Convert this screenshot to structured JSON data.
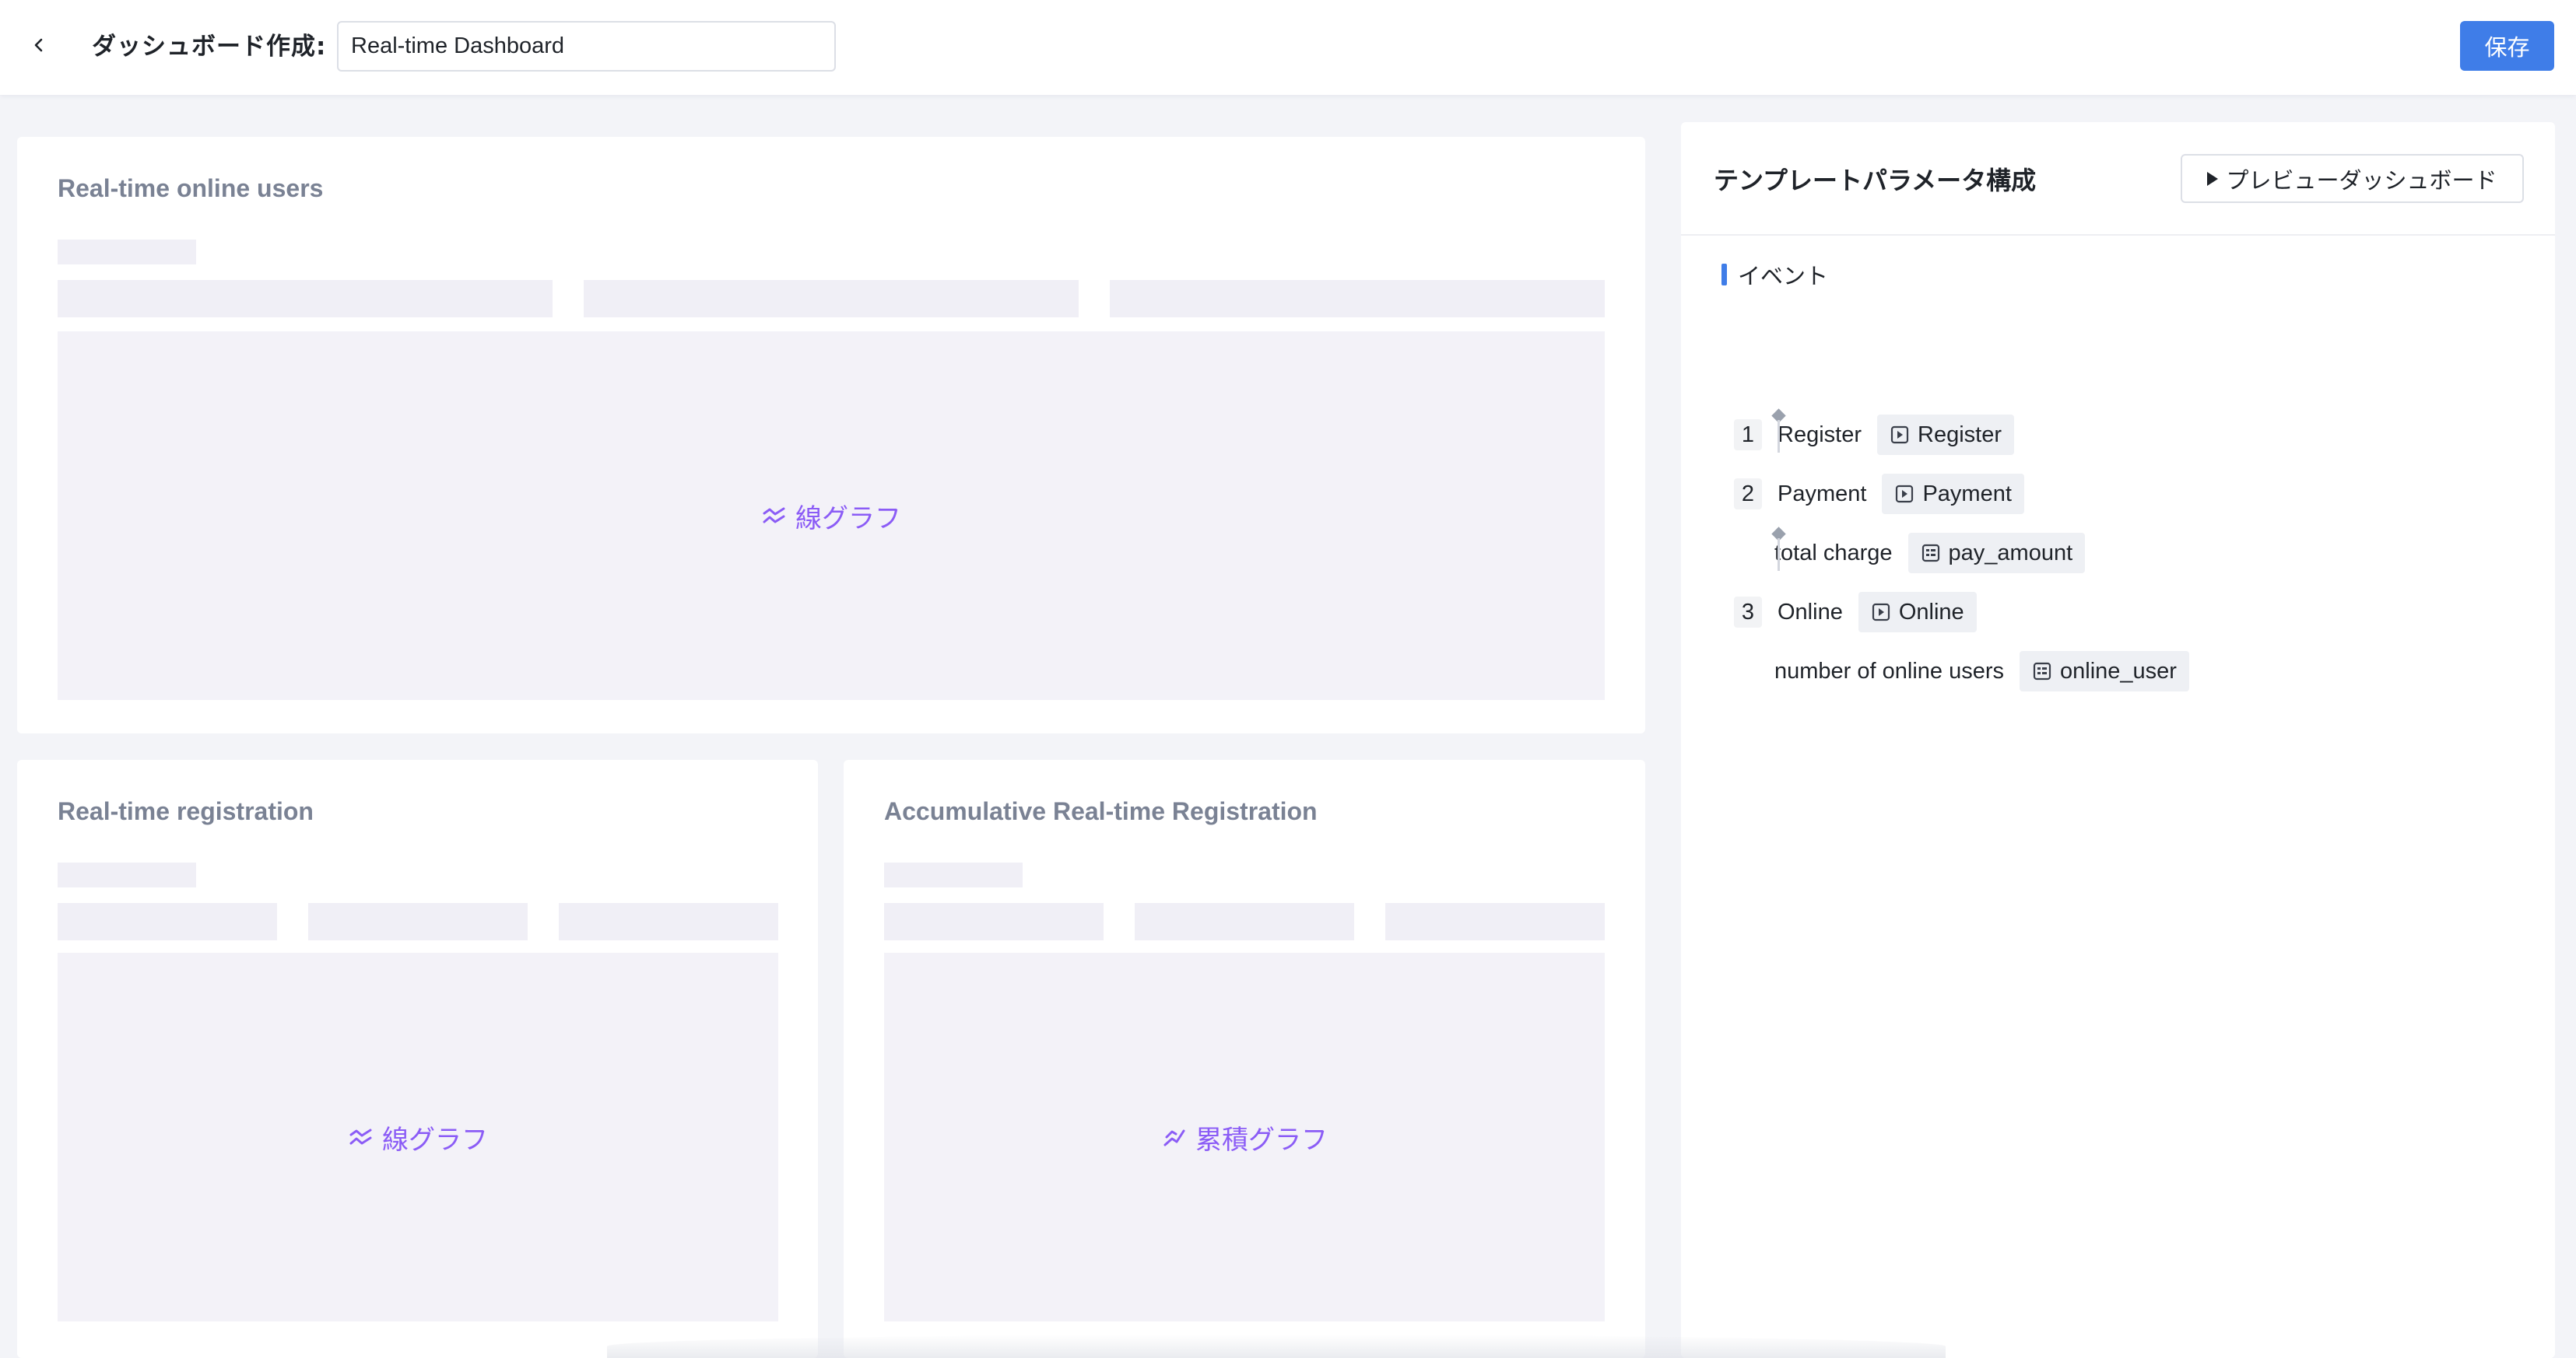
{
  "header": {
    "title": "ダッシュボード作成:",
    "name_value": "Real-time Dashboard",
    "save_label": "保存"
  },
  "widgets": [
    {
      "title": "Real-time online users",
      "chart_label": "線グラフ",
      "chart_icon": "line-chart-icon"
    },
    {
      "title": "Real-time registration",
      "chart_label": "線グラフ",
      "chart_icon": "line-chart-icon"
    },
    {
      "title": "Accumulative Real-time Registration",
      "chart_label": "累積グラフ",
      "chart_icon": "cumulative-chart-icon"
    }
  ],
  "panel": {
    "title": "テンプレートパラメータ構成",
    "preview_label": "プレビューダッシュボード",
    "section_label": "イベント",
    "events": [
      {
        "num": "1",
        "name": "Register",
        "tag": "Register"
      },
      {
        "num": "2",
        "name": "Payment",
        "tag": "Payment",
        "props": [
          {
            "name": "total charge",
            "tag": "pay_amount"
          }
        ]
      },
      {
        "num": "3",
        "name": "Online",
        "tag": "Online",
        "props": [
          {
            "name": "number of online users",
            "tag": "online_user"
          }
        ]
      }
    ]
  },
  "colors": {
    "accent": "#3f7de8",
    "chart_label": "#8b5cf6",
    "background": "#f3f4f8"
  }
}
